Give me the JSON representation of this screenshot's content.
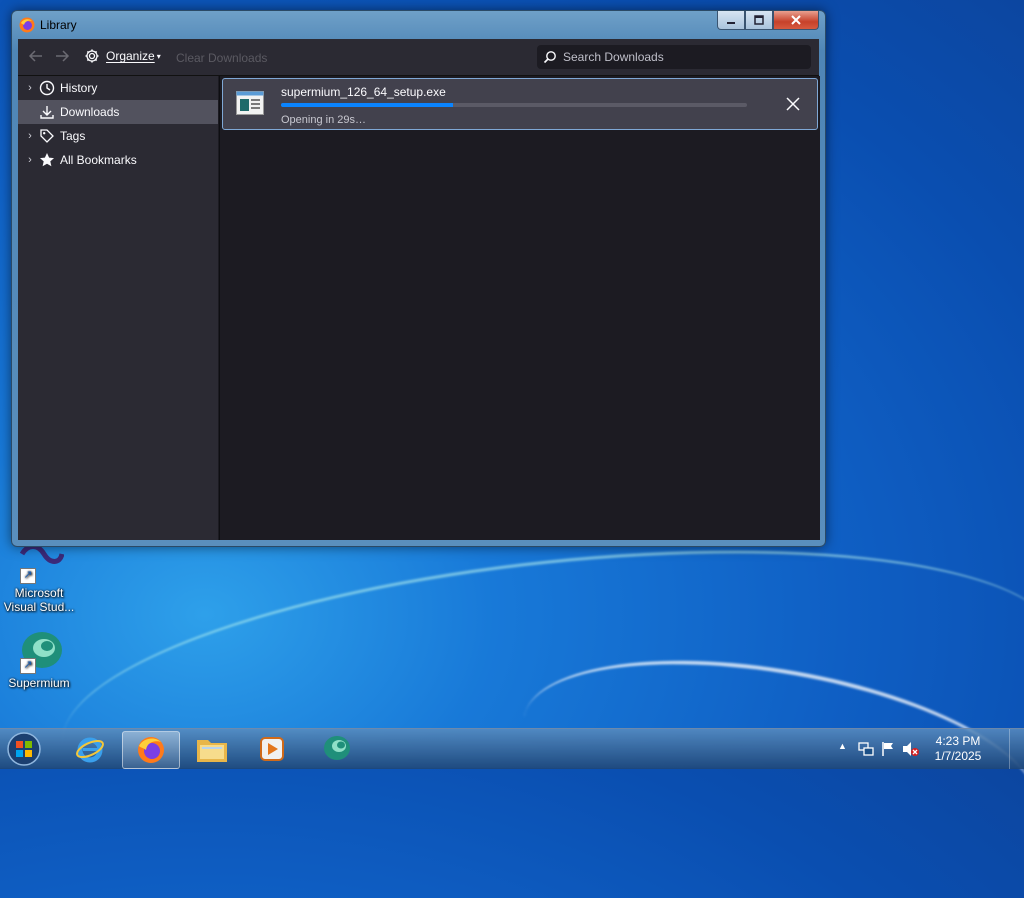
{
  "window": {
    "title": "Library",
    "controls": {
      "minimize": "minimize",
      "maximize": "maximize",
      "close": "close"
    }
  },
  "toolbar": {
    "organize_label": "Organize",
    "clear_label": "Clear Downloads",
    "search_placeholder": "Search Downloads"
  },
  "sidebar": {
    "items": [
      {
        "label": "History",
        "icon": "clock-icon",
        "expandable": true,
        "selected": false
      },
      {
        "label": "Downloads",
        "icon": "download-icon",
        "expandable": false,
        "selected": true
      },
      {
        "label": "Tags",
        "icon": "tag-icon",
        "expandable": true,
        "selected": false
      },
      {
        "label": "All Bookmarks",
        "icon": "star-icon",
        "expandable": true,
        "selected": false
      }
    ]
  },
  "downloads": [
    {
      "filename": "supermium_126_64_setup.exe",
      "status": "Opening in 29s…",
      "progress": 0.37
    }
  ],
  "desktop": {
    "icons": [
      {
        "label": "Microsoft Visual Stud..."
      },
      {
        "label": "Supermium"
      }
    ]
  },
  "taskbar": {
    "apps": [
      "start-orb",
      "internet-explorer",
      "firefox",
      "file-explorer",
      "media-player",
      "supermium"
    ],
    "active_app": "firefox",
    "clock": {
      "time": "4:23 PM",
      "date": "1/7/2025"
    }
  },
  "colors": {
    "accent": "#0a84ff",
    "window_bg": "#1c1b22",
    "sidebar_bg": "#2b2a33",
    "selected_bg": "#52525e"
  }
}
